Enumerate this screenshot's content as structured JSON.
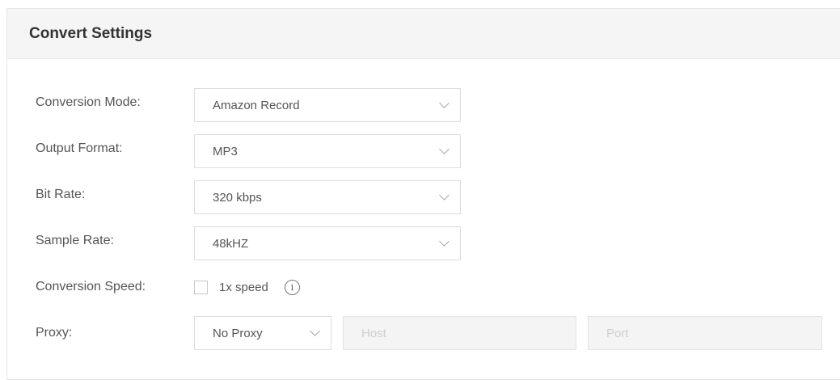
{
  "header": {
    "title": "Convert Settings"
  },
  "conversion_mode": {
    "label": "Conversion Mode:",
    "value": "Amazon Record"
  },
  "output_format": {
    "label": "Output Format:",
    "value": "MP3"
  },
  "bit_rate": {
    "label": "Bit Rate:",
    "value": "320 kbps"
  },
  "sample_rate": {
    "label": "Sample Rate:",
    "value": "48kHZ"
  },
  "conversion_speed": {
    "label": "Conversion Speed:",
    "option_label": "1x speed",
    "checked": false,
    "info_icon": "info-icon"
  },
  "proxy": {
    "label": "Proxy:",
    "value": "No Proxy",
    "host_placeholder": "Host",
    "port_placeholder": "Port"
  }
}
